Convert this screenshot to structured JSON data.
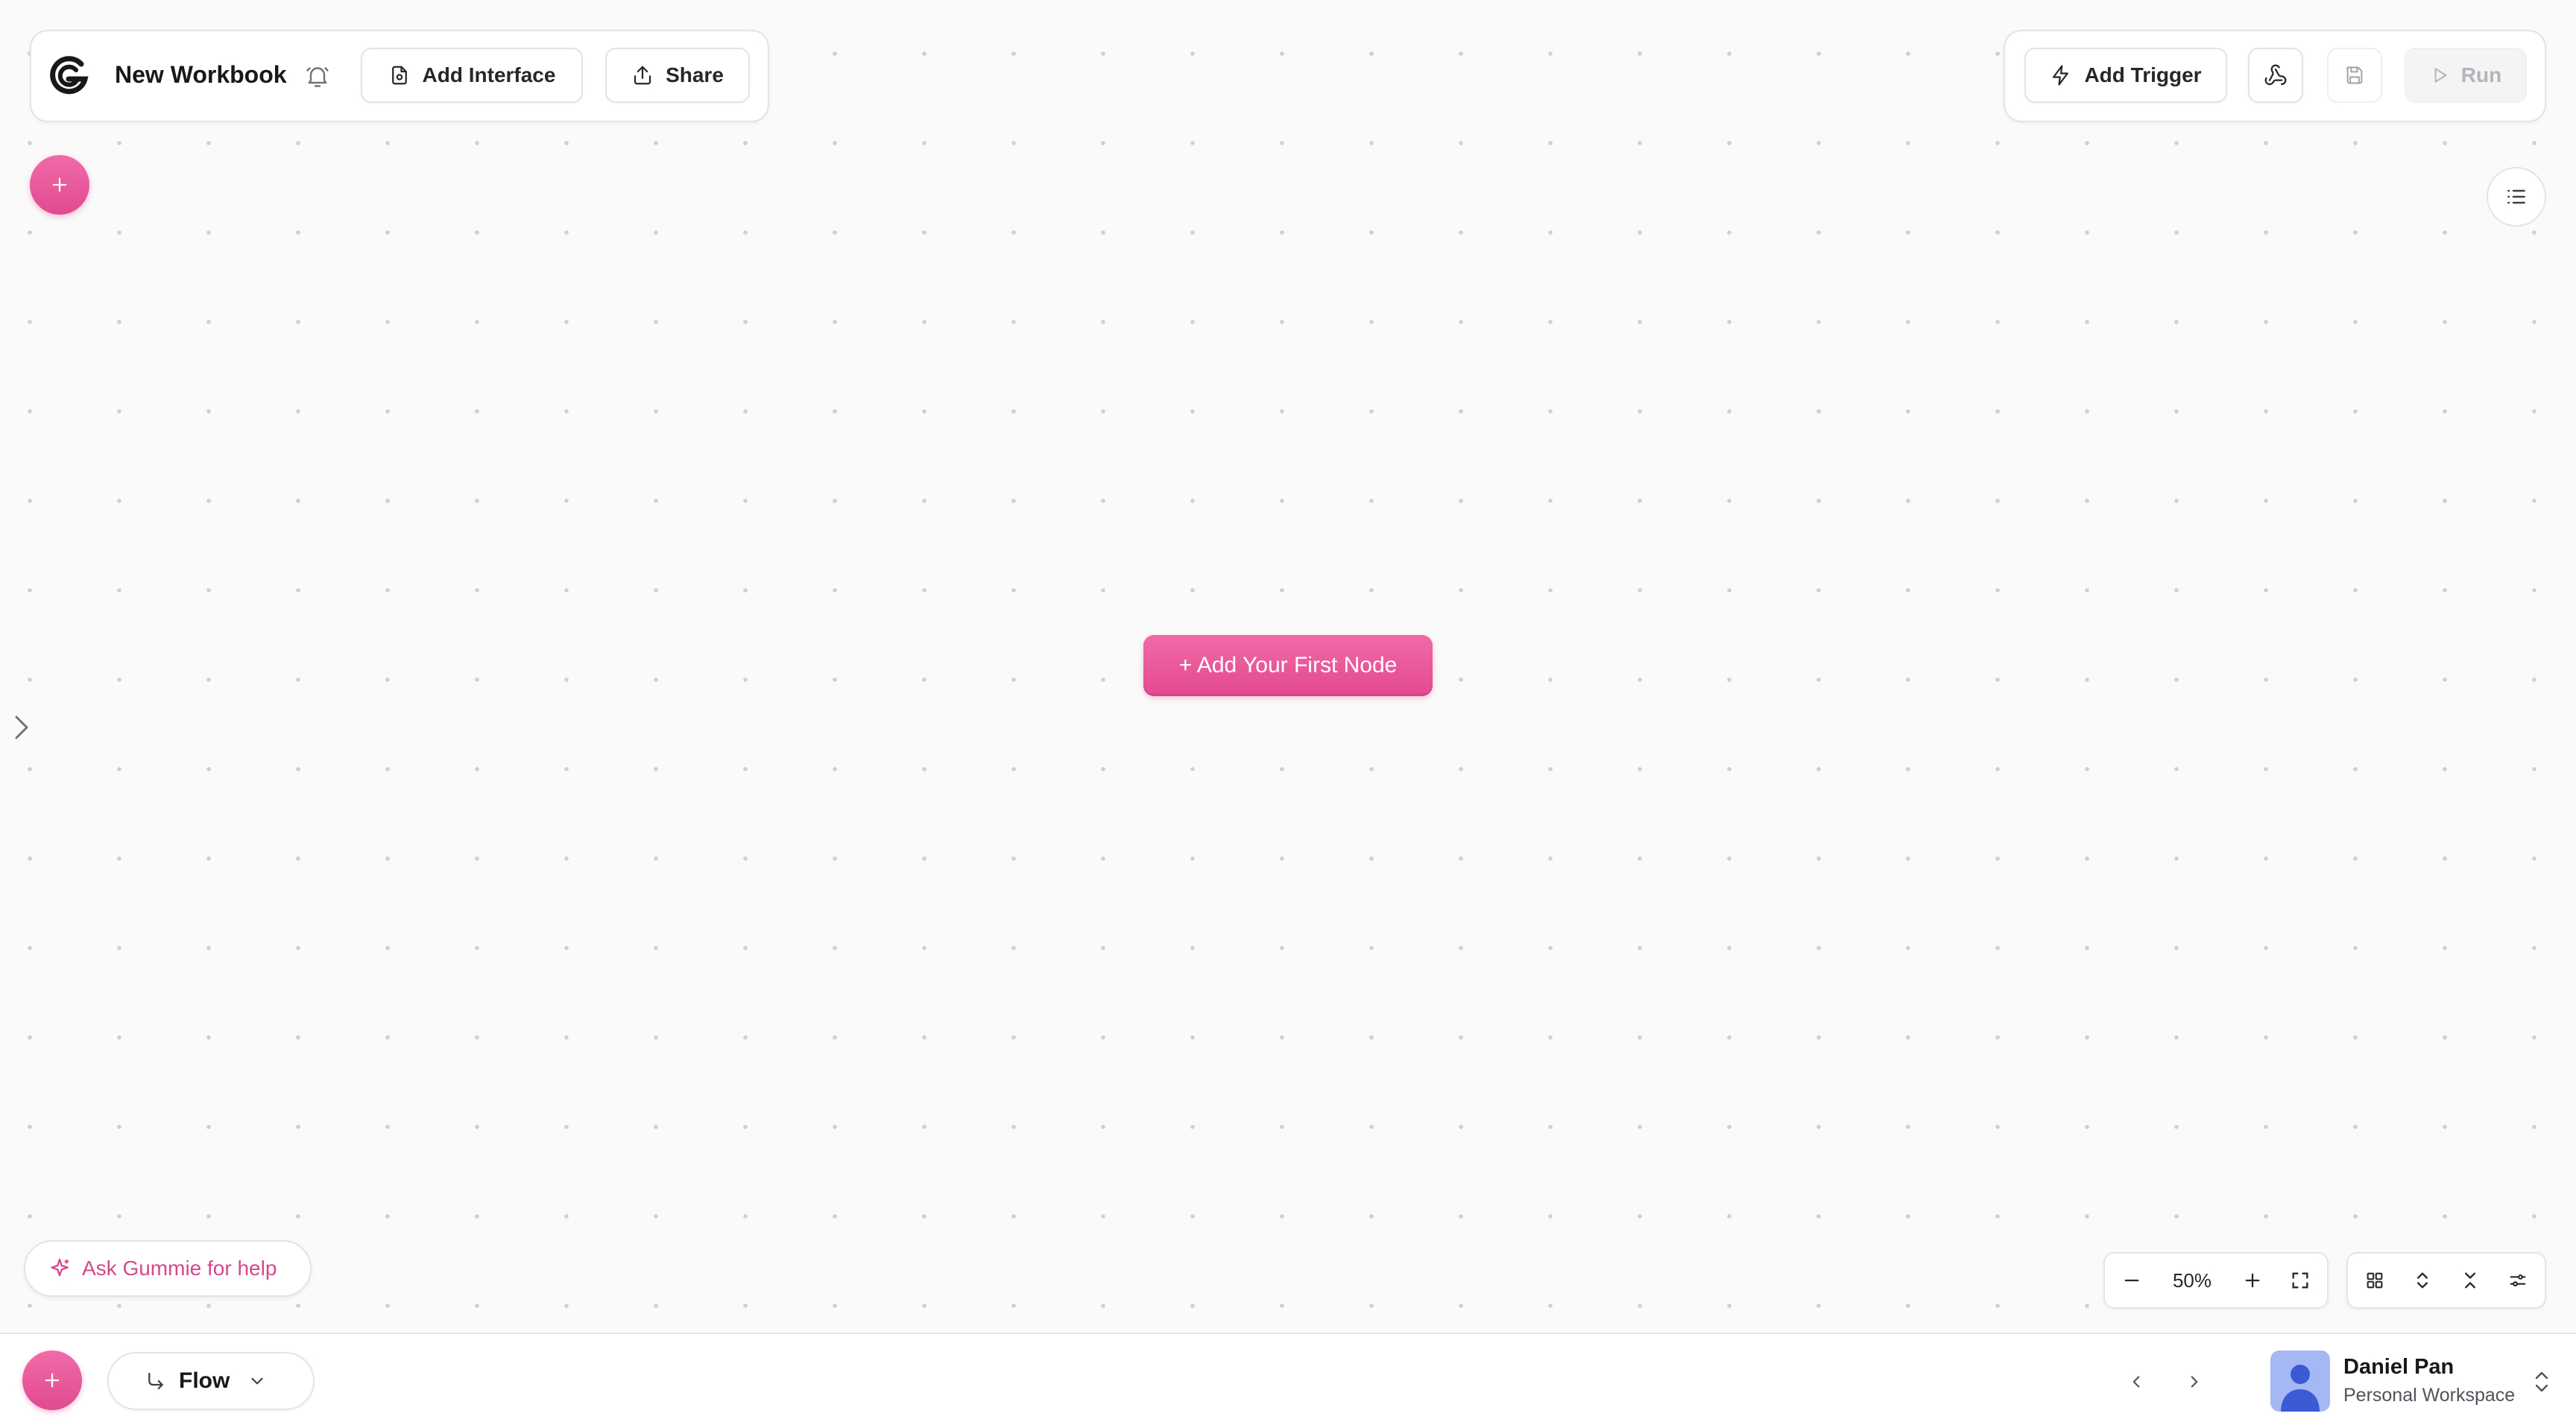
{
  "workbook": {
    "title": "New Workbook"
  },
  "toolbar_left": {
    "add_interface_label": "Add Interface",
    "share_label": "Share"
  },
  "toolbar_right": {
    "add_trigger_label": "Add Trigger",
    "run_label": "Run"
  },
  "canvas": {
    "add_first_node_label": "+ Add Your First Node"
  },
  "assistant": {
    "label": "Ask Gummie for help"
  },
  "zoom": {
    "level": "50%"
  },
  "bottom_bar": {
    "flow_label": "Flow"
  },
  "user": {
    "name": "Daniel Pan",
    "workspace": "Personal Workspace"
  },
  "colors": {
    "accent_pink": "#e4498f",
    "background": "#fafafa",
    "border": "#e4e4e7",
    "avatar_bg": "#a5b8f4"
  },
  "icons": [
    "logo-icon",
    "bell-icon",
    "interface-icon",
    "share-icon",
    "bolt-icon",
    "webhook-icon",
    "save-icon",
    "play-icon",
    "plus-icon",
    "list-icon",
    "chevron-right-icon",
    "sparkle-icon",
    "minus-icon",
    "fullscreen-icon",
    "grid-icon",
    "expand-icon",
    "collapse-icon",
    "settings-icon",
    "flow-arrow-icon",
    "chevron-down-icon",
    "chevron-left-icon",
    "user-icon",
    "chevron-updown-icon"
  ]
}
